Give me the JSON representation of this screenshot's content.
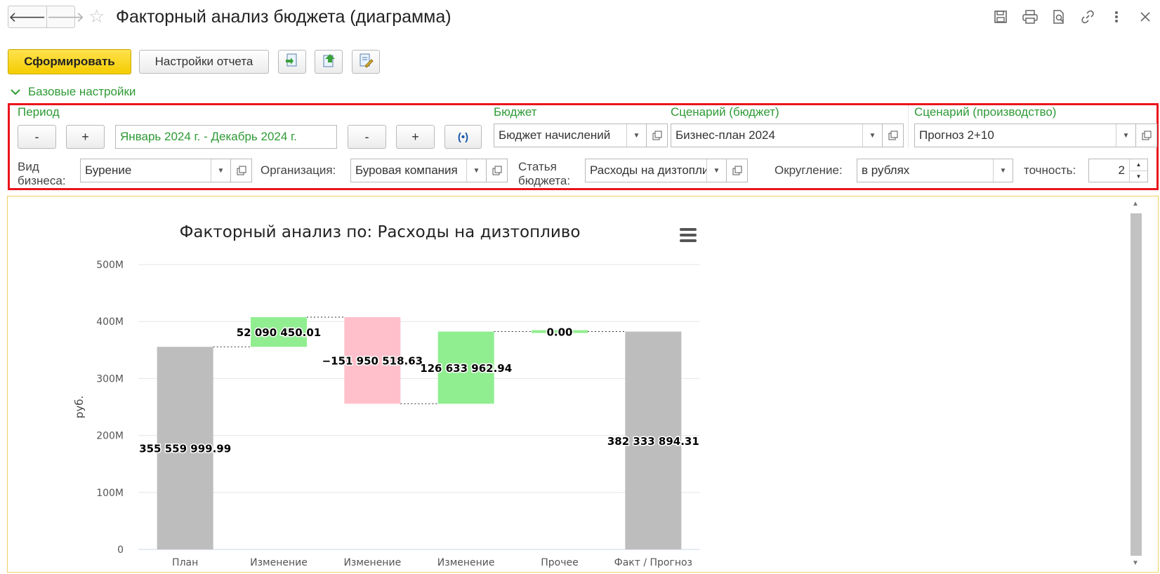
{
  "window": {
    "title": "Факторный анализ бюджета (диаграмма)",
    "nav_back": "🡐",
    "nav_forward": "🡒",
    "icons": [
      "save-icon",
      "print-icon",
      "preview-icon",
      "link-icon",
      "more-icon",
      "close-icon"
    ]
  },
  "toolbar": {
    "generate_label": "Сформировать",
    "settings_label": "Настройки отчета"
  },
  "settings": {
    "section_label": "Базовые настройки",
    "period_label": "Период",
    "period_minus": "-",
    "period_plus": "+",
    "period_value": "Январь 2024 г. - Декабрь 2024 г.",
    "period_minus2": "-",
    "period_plus2": "+",
    "period_choose": "(•)",
    "budget_label": "Бюджет",
    "budget_value": "Бюджет начислений",
    "scenario_budget_label": "Сценарий (бюджет)",
    "scenario_budget_value": "Бизнес-план 2024",
    "scenario_prod_label": "Сценарий (производство)",
    "scenario_prod_value": "Прогноз 2+10",
    "business_type_label_1": "Вид",
    "business_type_label_2": "бизнеса:",
    "business_type_value": "Бурение",
    "org_label": "Организация:",
    "org_value": "Буровая компания",
    "article_label_1": "Статья",
    "article_label_2": "бюджета:",
    "article_value": "Расходы на дизтопливо",
    "rounding_label": "Округление:",
    "rounding_value": "в рублях",
    "precision_label": "точность:",
    "precision_value": "2"
  },
  "chart_data": {
    "type": "bar",
    "subtype": "waterfall",
    "title": "Факторный анализ по: Расходы на дизтопливо",
    "ylabel": "руб.",
    "ylim": [
      0,
      500000000
    ],
    "yticks": [
      "0",
      "100M",
      "200M",
      "300M",
      "400M",
      "500M"
    ],
    "grid": true,
    "categories": [
      "План",
      "Изменение",
      "Изменение",
      "Изменение",
      "Прочее",
      "Факт / Прогноз"
    ],
    "values": [
      355559999.99,
      52090450.01,
      -151950518.63,
      126633962.94,
      0.0,
      382333894.31
    ],
    "labels": [
      "355 559 999.99",
      "52 090 450.01",
      "−151 950 518.63",
      "126 633 962.94",
      "0.00",
      "382 333 894.31"
    ],
    "colors": {
      "total": "#bdbdbd",
      "increase": "#90ee90",
      "decrease": "#ffc0cb"
    }
  }
}
